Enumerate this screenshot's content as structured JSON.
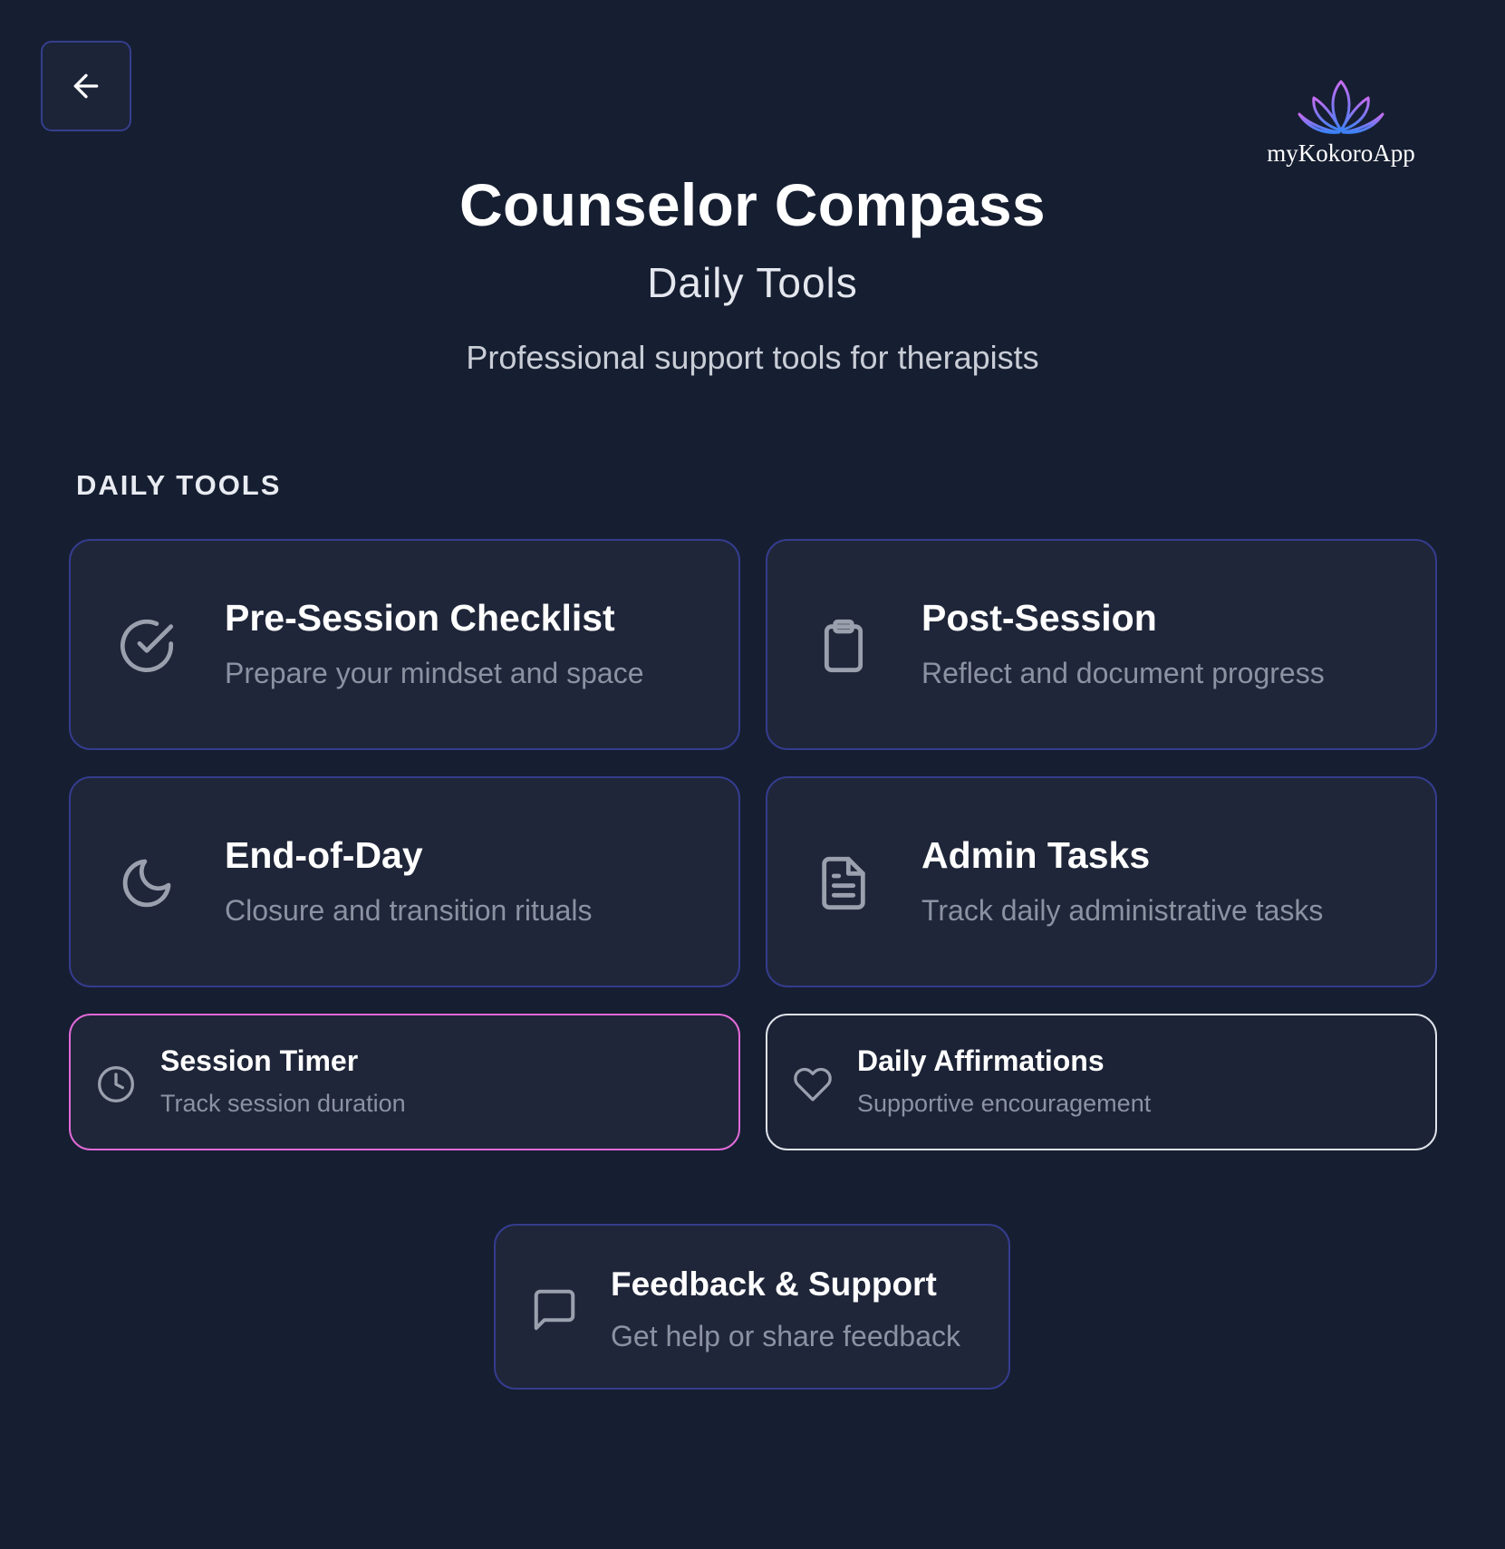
{
  "header": {
    "back_label": "Back",
    "logo_text": "myKokoroApp",
    "title": "Counselor Compass",
    "subtitle": "Daily Tools",
    "tagline": "Professional support tools for therapists"
  },
  "section": {
    "label": "DAILY TOOLS"
  },
  "tools": [
    {
      "title": "Pre-Session Checklist",
      "description": "Prepare your mindset and space",
      "icon": "check-circle-icon"
    },
    {
      "title": "Post-Session",
      "description": "Reflect and document progress",
      "icon": "clipboard-icon"
    },
    {
      "title": "End-of-Day",
      "description": "Closure and transition rituals",
      "icon": "moon-icon"
    },
    {
      "title": "Admin Tasks",
      "description": "Track daily administrative tasks",
      "icon": "document-icon"
    },
    {
      "title": "Session Timer",
      "description": "Track session duration",
      "icon": "clock-icon"
    },
    {
      "title": "Daily Affirmations",
      "description": "Supportive encouragement",
      "icon": "heart-icon"
    }
  ],
  "feedback": {
    "title": "Feedback & Support",
    "description": "Get help or share feedback",
    "icon": "chat-bubble-icon"
  },
  "colors": {
    "background": "#161e31",
    "card_background": "#1f2639",
    "card_border": "#343c8e",
    "timer_border": "#e06ad8",
    "affirmations_border": "#dfe2ea",
    "icon_gray": "#9aa0ad",
    "logo_gradient_start": "#c76cf0",
    "logo_gradient_end": "#3b82f6"
  }
}
